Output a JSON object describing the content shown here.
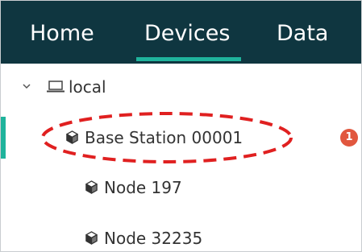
{
  "nav": {
    "tabs": [
      {
        "label": "Home"
      },
      {
        "label": "Devices",
        "active": true
      },
      {
        "label": "Data"
      }
    ],
    "background_color": "#0f3640",
    "active_underline_color": "#1fb39c"
  },
  "tree": {
    "root": {
      "label": "local",
      "icon": "laptop-icon",
      "expanded": true
    },
    "items": [
      {
        "label": "Base Station 00001",
        "icon": "cube-icon",
        "selected": true,
        "badge": "1",
        "highlighted_with": "red-dashed-ellipse"
      },
      {
        "label": "Node 197",
        "icon": "cube-icon"
      },
      {
        "label": "Node 32235",
        "icon": "cube-icon"
      }
    ],
    "selection_color": "#1fb39c",
    "badge_color": "#e1573e",
    "annotation_color": "#e02020"
  }
}
